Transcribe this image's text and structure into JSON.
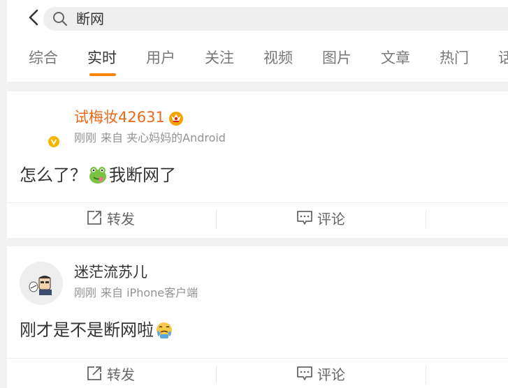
{
  "search": {
    "query": "断网"
  },
  "tabs": [
    "综合",
    "实时",
    "用户",
    "关注",
    "视频",
    "图片",
    "文章",
    "热门",
    "话"
  ],
  "active_tab_index": 1,
  "accent_color": "#ff8200",
  "posts": [
    {
      "username": "试梅妆42631",
      "username_color": "#ea6a1c",
      "time": "刚刚",
      "source": "来自 夹心妈妈的Android",
      "text_before": "怎么了？",
      "emoji_icon": "frog-icon",
      "text_after": "我断网了",
      "verified": true,
      "actions": {
        "repost": "转发",
        "comment": "评论"
      }
    },
    {
      "username": "迷茫流苏儿",
      "time": "刚刚",
      "source": "来自 iPhone客户端",
      "text_before": "刚才是不是断网啦",
      "emoji_icon": "crying-face-icon",
      "actions": {
        "repost": "转发",
        "comment": "评论"
      }
    }
  ]
}
